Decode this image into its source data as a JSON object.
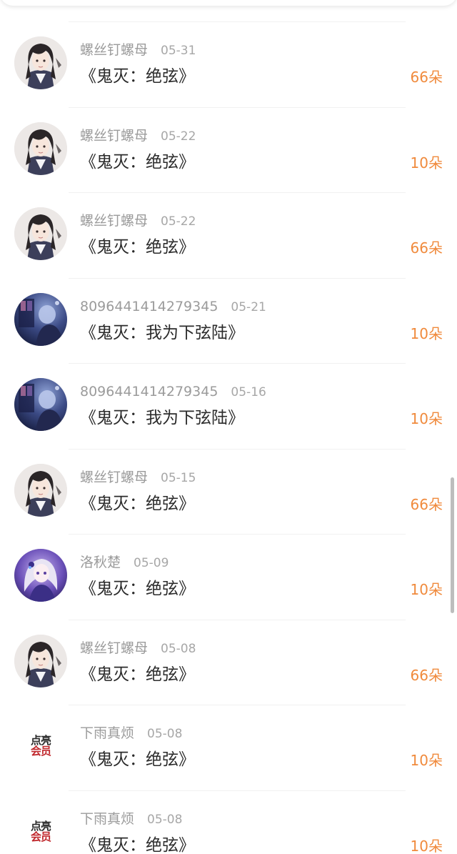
{
  "donations": [
    {
      "user": "螺丝钉螺母",
      "date": "05-31",
      "work": "《鬼灭：绝弦》",
      "amount": "66朵",
      "avatar": "avatar-man-longhair"
    },
    {
      "user": "螺丝钉螺母",
      "date": "05-22",
      "work": "《鬼灭：绝弦》",
      "amount": "10朵",
      "avatar": "avatar-man-longhair"
    },
    {
      "user": "螺丝钉螺母",
      "date": "05-22",
      "work": "《鬼灭：绝弦》",
      "amount": "66朵",
      "avatar": "avatar-man-longhair"
    },
    {
      "user": "8096441414279345",
      "date": "05-21",
      "work": "《鬼灭：我为下弦陆》",
      "amount": "10朵",
      "avatar": "avatar-night-scene"
    },
    {
      "user": "8096441414279345",
      "date": "05-16",
      "work": "《鬼灭：我为下弦陆》",
      "amount": "10朵",
      "avatar": "avatar-night-scene"
    },
    {
      "user": "螺丝钉螺母",
      "date": "05-15",
      "work": "《鬼灭：绝弦》",
      "amount": "66朵",
      "avatar": "avatar-man-longhair"
    },
    {
      "user": "洛秋楚",
      "date": "05-09",
      "work": "《鬼灭：绝弦》",
      "amount": "10朵",
      "avatar": "avatar-anime-girl"
    },
    {
      "user": "螺丝钉螺母",
      "date": "05-08",
      "work": "《鬼灭：绝弦》",
      "amount": "66朵",
      "avatar": "avatar-man-longhair"
    },
    {
      "user": "下雨真烦",
      "date": "05-08",
      "work": "《鬼灭：绝弦》",
      "amount": "10朵",
      "avatar": "avatar-vip-badge"
    },
    {
      "user": "下雨真烦",
      "date": "05-08",
      "work": "《鬼灭：绝弦》",
      "amount": "10朵",
      "avatar": "avatar-vip-badge"
    }
  ],
  "vip_badge": {
    "line1": "点亮",
    "line2": "会员"
  },
  "colors": {
    "amount": "#f08a3c",
    "title": "#2b2b2b",
    "meta": "#9b9b9b",
    "vip_red": "#c0282d"
  }
}
